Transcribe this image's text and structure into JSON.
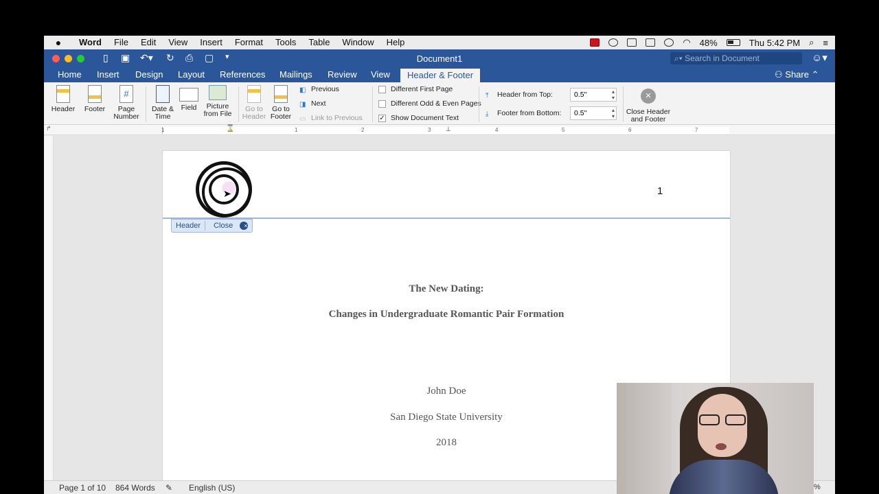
{
  "menubar": {
    "app": "Word",
    "items": [
      "File",
      "Edit",
      "View",
      "Insert",
      "Format",
      "Tools",
      "Table",
      "Window",
      "Help"
    ],
    "battery": "48%",
    "clock": "Thu 5:42 PM"
  },
  "window": {
    "title": "Document1",
    "search_placeholder": "Search in Document",
    "share": "Share"
  },
  "tabs": [
    "Home",
    "Insert",
    "Design",
    "Layout",
    "References",
    "Mailings",
    "Review",
    "View",
    "Header & Footer"
  ],
  "active_tab": "Header & Footer",
  "ribbon": {
    "header": "Header",
    "footer": "Footer",
    "page_number": [
      "Page",
      "Number"
    ],
    "date_time": [
      "Date &",
      "Time"
    ],
    "field": "Field",
    "picture": [
      "Picture",
      "from File"
    ],
    "go_header": [
      "Go to",
      "Header"
    ],
    "go_footer": [
      "Go to",
      "Footer"
    ],
    "previous": "Previous",
    "next": "Next",
    "link_previous": "Link to Previous",
    "diff_first": "Different First Page",
    "diff_odd_even": "Different Odd & Even Pages",
    "show_doc_text": "Show Document Text",
    "show_doc_text_checked": true,
    "header_from_top_label": "Header from Top:",
    "header_from_top_value": "0.5\"",
    "footer_from_bottom_label": "Footer from Bottom:",
    "footer_from_bottom_value": "0.5\"",
    "close": [
      "Close Header",
      "and Footer"
    ]
  },
  "ruler_numbers": [
    "1",
    "1",
    "2",
    "3",
    "4",
    "5",
    "6",
    "7"
  ],
  "document": {
    "page_number": "1",
    "header_tag": "Header",
    "header_close": "Close",
    "title_line1": "The New Dating:",
    "title_line2": "Changes in Undergraduate Romantic Pair Formation",
    "author": "John Doe",
    "institution": "San Diego State University",
    "year": "2018"
  },
  "status": {
    "page": "Page 1 of 10",
    "words": "864 Words",
    "language": "English (US)",
    "zoom_fragment": "%"
  }
}
